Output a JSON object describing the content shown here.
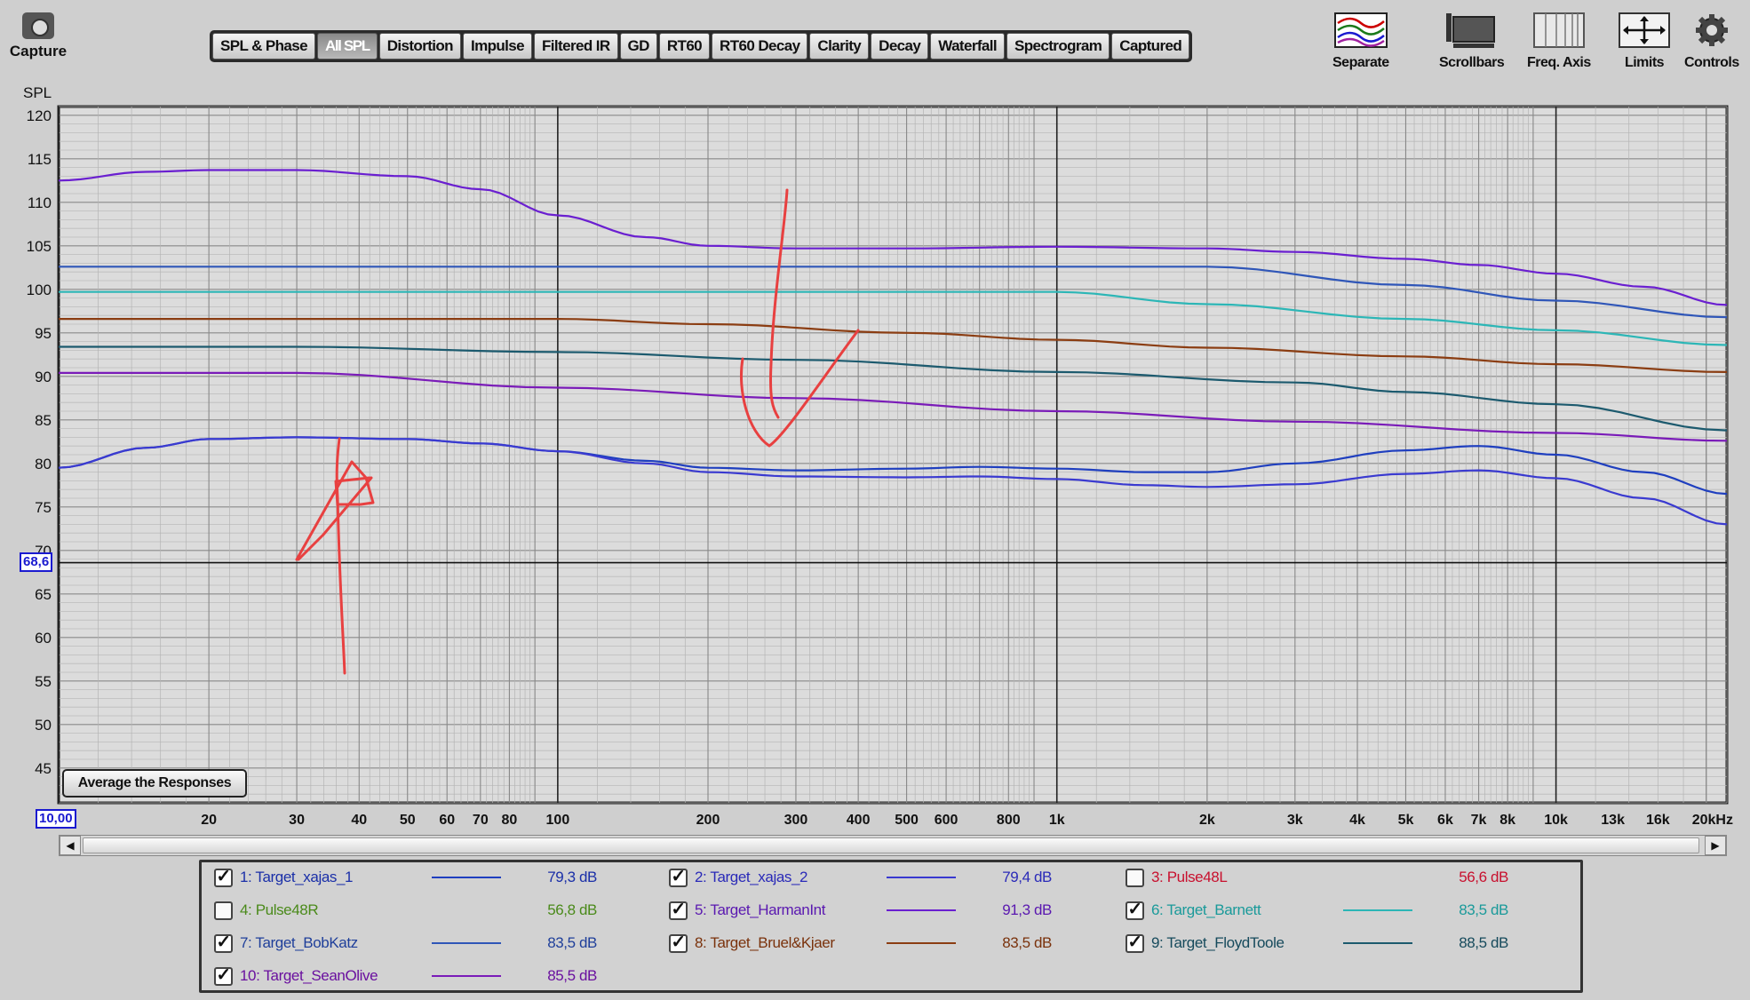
{
  "toolbar": {
    "capture_label": "Capture",
    "tabs": [
      {
        "label": "SPL & Phase",
        "active": false
      },
      {
        "label": "All SPL",
        "active": true
      },
      {
        "label": "Distortion",
        "active": false
      },
      {
        "label": "Impulse",
        "active": false
      },
      {
        "label": "Filtered IR",
        "active": false
      },
      {
        "label": "GD",
        "active": false
      },
      {
        "label": "RT60",
        "active": false
      },
      {
        "label": "RT60 Decay",
        "active": false
      },
      {
        "label": "Clarity",
        "active": false
      },
      {
        "label": "Decay",
        "active": false
      },
      {
        "label": "Waterfall",
        "active": false
      },
      {
        "label": "Spectrogram",
        "active": false
      },
      {
        "label": "Captured",
        "active": false
      }
    ],
    "tools": [
      "Separate",
      "Scrollbars",
      "Freq. Axis",
      "Limits",
      "Controls"
    ]
  },
  "chart": {
    "y_unit": "SPL",
    "cursor_y": "68,6",
    "cursor_x": "10,00",
    "avg_button": "Average the Responses"
  },
  "chart_data": {
    "type": "line",
    "xscale": "log",
    "xlim": [
      10,
      22000
    ],
    "ylim": [
      41,
      121
    ],
    "yticks": [
      120,
      115,
      110,
      105,
      100,
      95,
      90,
      85,
      80,
      75,
      70,
      65,
      60,
      55,
      50,
      45
    ],
    "xtick_labels": [
      {
        "v": 20,
        "t": "20"
      },
      {
        "v": 30,
        "t": "30"
      },
      {
        "v": 40,
        "t": "40"
      },
      {
        "v": 50,
        "t": "50"
      },
      {
        "v": 60,
        "t": "60"
      },
      {
        "v": 70,
        "t": "70"
      },
      {
        "v": 80,
        "t": "80"
      },
      {
        "v": 100,
        "t": "100"
      },
      {
        "v": 200,
        "t": "200"
      },
      {
        "v": 300,
        "t": "300"
      },
      {
        "v": 400,
        "t": "400"
      },
      {
        "v": 500,
        "t": "500"
      },
      {
        "v": 600,
        "t": "600"
      },
      {
        "v": 800,
        "t": "800"
      },
      {
        "v": 1000,
        "t": "1k"
      },
      {
        "v": 2000,
        "t": "2k"
      },
      {
        "v": 3000,
        "t": "3k"
      },
      {
        "v": 4000,
        "t": "4k"
      },
      {
        "v": 5000,
        "t": "5k"
      },
      {
        "v": 6000,
        "t": "6k"
      },
      {
        "v": 7000,
        "t": "7k"
      },
      {
        "v": 8000,
        "t": "8k"
      },
      {
        "v": 10000,
        "t": "10k"
      },
      {
        "v": 13000,
        "t": "13k"
      },
      {
        "v": 16000,
        "t": "16k"
      },
      {
        "v": 20000,
        "t": "20kHz"
      }
    ],
    "series": [
      {
        "name": "1: Target_xajas_1",
        "color": "#1f3fbf",
        "points": [
          [
            10,
            79.5
          ],
          [
            15,
            81.8
          ],
          [
            20,
            82.8
          ],
          [
            30,
            83.0
          ],
          [
            50,
            82.8
          ],
          [
            70,
            82.3
          ],
          [
            100,
            81.4
          ],
          [
            150,
            80.3
          ],
          [
            200,
            79.5
          ],
          [
            300,
            79.2
          ],
          [
            500,
            79.4
          ],
          [
            700,
            79.6
          ],
          [
            1000,
            79.4
          ],
          [
            1500,
            79.0
          ],
          [
            2000,
            79.0
          ],
          [
            3000,
            80.0
          ],
          [
            5000,
            81.5
          ],
          [
            7000,
            82.0
          ],
          [
            10000,
            81.0
          ],
          [
            15000,
            79.0
          ],
          [
            22000,
            76.5
          ]
        ]
      },
      {
        "name": "2: Target_xajas_2",
        "color": "#3a3ad0",
        "points": [
          [
            10,
            79.5
          ],
          [
            15,
            81.8
          ],
          [
            20,
            82.8
          ],
          [
            30,
            83.0
          ],
          [
            50,
            82.8
          ],
          [
            70,
            82.3
          ],
          [
            100,
            81.4
          ],
          [
            150,
            80.0
          ],
          [
            200,
            79.0
          ],
          [
            300,
            78.5
          ],
          [
            500,
            78.4
          ],
          [
            700,
            78.5
          ],
          [
            1000,
            78.2
          ],
          [
            1500,
            77.5
          ],
          [
            2000,
            77.3
          ],
          [
            3000,
            77.6
          ],
          [
            5000,
            78.8
          ],
          [
            7000,
            79.2
          ],
          [
            10000,
            78.3
          ],
          [
            15000,
            76.0
          ],
          [
            22000,
            73.0
          ]
        ]
      },
      {
        "name": "5: Target_HarmanInt",
        "color": "#6a1fd0",
        "points": [
          [
            10,
            112.5
          ],
          [
            15,
            113.5
          ],
          [
            20,
            113.7
          ],
          [
            30,
            113.7
          ],
          [
            50,
            113.0
          ],
          [
            70,
            111.5
          ],
          [
            100,
            108.5
          ],
          [
            150,
            106.0
          ],
          [
            200,
            105.0
          ],
          [
            300,
            104.7
          ],
          [
            500,
            104.7
          ],
          [
            1000,
            104.9
          ],
          [
            2000,
            104.7
          ],
          [
            3000,
            104.3
          ],
          [
            5000,
            103.5
          ],
          [
            7000,
            102.8
          ],
          [
            10000,
            101.8
          ],
          [
            15000,
            100.3
          ],
          [
            22000,
            98.2
          ]
        ]
      },
      {
        "name": "6: Target_Barnett",
        "color": "#2cb6b6",
        "points": [
          [
            10,
            99.7
          ],
          [
            1000,
            99.7
          ],
          [
            2000,
            98.3
          ],
          [
            5000,
            96.6
          ],
          [
            10000,
            95.3
          ],
          [
            22000,
            93.6
          ]
        ]
      },
      {
        "name": "7: Target_BobKatz",
        "color": "#2f56b8",
        "points": [
          [
            10,
            102.6
          ],
          [
            2000,
            102.6
          ],
          [
            5000,
            100.5
          ],
          [
            10000,
            98.7
          ],
          [
            22000,
            96.8
          ]
        ]
      },
      {
        "name": "8: Target_Bruel&Kjaer",
        "color": "#8b3d12",
        "points": [
          [
            10,
            96.6
          ],
          [
            100,
            96.6
          ],
          [
            200,
            96.0
          ],
          [
            500,
            95.0
          ],
          [
            1000,
            94.2
          ],
          [
            2000,
            93.3
          ],
          [
            5000,
            92.3
          ],
          [
            10000,
            91.4
          ],
          [
            22000,
            90.5
          ]
        ]
      },
      {
        "name": "9: Target_FloydToole",
        "color": "#1c5a6e",
        "points": [
          [
            10,
            93.4
          ],
          [
            30,
            93.4
          ],
          [
            100,
            92.8
          ],
          [
            300,
            91.9
          ],
          [
            1000,
            90.5
          ],
          [
            3000,
            89.3
          ],
          [
            5000,
            88.2
          ],
          [
            10000,
            86.8
          ],
          [
            22000,
            83.8
          ]
        ]
      },
      {
        "name": "10: Target_SeanOlive",
        "color": "#7a1bb8",
        "points": [
          [
            10,
            90.4
          ],
          [
            30,
            90.4
          ],
          [
            100,
            88.7
          ],
          [
            300,
            87.5
          ],
          [
            1000,
            86.0
          ],
          [
            3000,
            84.8
          ],
          [
            10000,
            83.5
          ],
          [
            22000,
            82.6
          ]
        ]
      }
    ],
    "annotations": [
      {
        "kind": "freehand-arrow",
        "color": "#e84040",
        "direction": "up"
      },
      {
        "kind": "freehand-arrow",
        "color": "#e84040",
        "direction": "down"
      }
    ]
  },
  "scrollbar": {
    "left_arrow": "◀",
    "right_arrow": "▶"
  },
  "legend": [
    {
      "name": "1: Target_xajas_1",
      "checked": true,
      "color": "#1f3fbf",
      "value": "79,3 dB",
      "text_color": "#1a2fa8",
      "line": true
    },
    {
      "name": "2: Target_xajas_2",
      "checked": true,
      "color": "#3a3ad0",
      "value": "79,4 dB",
      "text_color": "#2a2ab8",
      "line": true
    },
    {
      "name": "3: Pulse48L",
      "checked": false,
      "color": "#c8102e",
      "value": "56,6 dB",
      "text_color": "#c8102e",
      "line": false
    },
    {
      "name": "4: Pulse48R",
      "checked": false,
      "color": "#4a8a1a",
      "value": "56,8 dB",
      "text_color": "#4a8a1a",
      "line": false
    },
    {
      "name": "5: Target_HarmanInt",
      "checked": true,
      "color": "#6a1fd0",
      "value": "91,3 dB",
      "text_color": "#5a18b0",
      "line": true
    },
    {
      "name": "6: Target_Barnett",
      "checked": true,
      "color": "#2cb6b6",
      "value": "83,5 dB",
      "text_color": "#1a9a9a",
      "line": true
    },
    {
      "name": "7: Target_BobKatz",
      "checked": true,
      "color": "#2f56b8",
      "value": "83,5 dB",
      "text_color": "#1f3f9a",
      "line": true
    },
    {
      "name": "8: Target_Bruel&Kjaer",
      "checked": true,
      "color": "#8b3d12",
      "value": "83,5 dB",
      "text_color": "#7a320c",
      "line": true
    },
    {
      "name": "9: Target_FloydToole",
      "checked": true,
      "color": "#1c5a6e",
      "value": "88,5 dB",
      "text_color": "#164a5c",
      "line": true
    },
    {
      "name": "10: Target_SeanOlive",
      "checked": true,
      "color": "#7a1bb8",
      "value": "85,5 dB",
      "text_color": "#6a109f",
      "line": true
    }
  ]
}
